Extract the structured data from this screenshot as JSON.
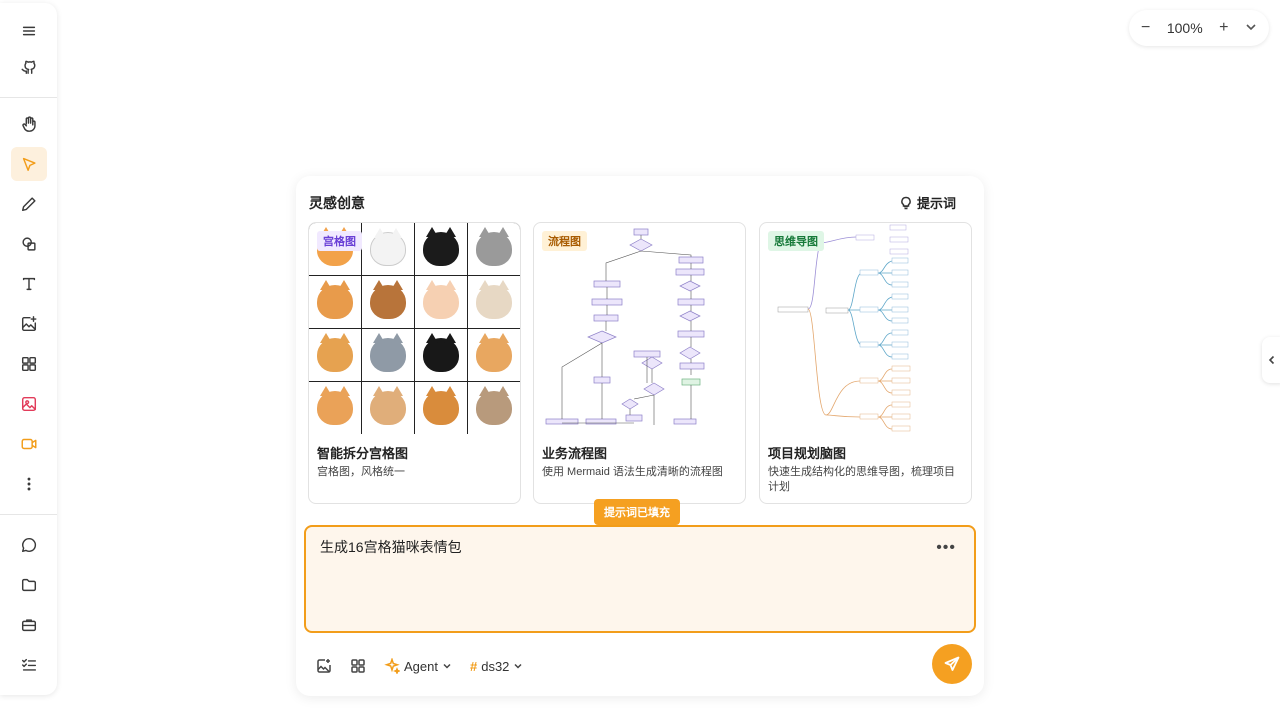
{
  "zoom": {
    "level": "100%",
    "minus": "−",
    "plus": "+"
  },
  "panel": {
    "title": "灵感创意",
    "tips_label": "提示词",
    "cards": [
      {
        "tag": "宫格图",
        "tag_color": "#6a3fd6",
        "tag_bg": "#f1e9ff",
        "title": "智能拆分宫格图",
        "desc": "宫格图，风格统一"
      },
      {
        "tag": "流程图",
        "tag_color": "#a85b00",
        "tag_bg": "#fff1d6",
        "title": "业务流程图",
        "desc": "使用 Mermaid 语法生成清晰的流程图"
      },
      {
        "tag": "思维导图",
        "tag_color": "#177a3a",
        "tag_bg": "#dff6e6",
        "title": "项目规划脑图",
        "desc": "快速生成结构化的思维导图，梳理项目计划"
      }
    ],
    "filled_badge": "提示词已填充",
    "prompt_value": "生成16宫格猫咪表情包",
    "agent_label": "Agent",
    "model_label": "ds32"
  },
  "colors": {
    "accent": "#f5a021",
    "active_tool_bg": "#fdf0dd"
  }
}
